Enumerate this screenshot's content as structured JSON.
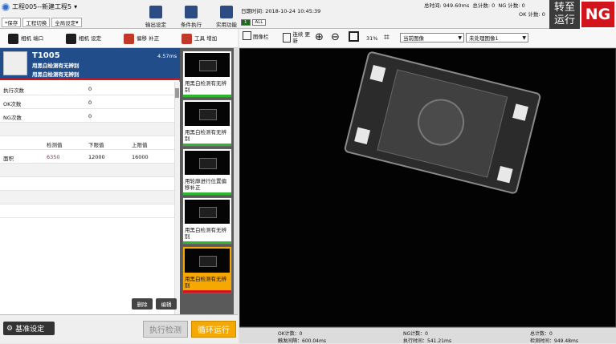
{
  "header": {
    "project": "工程005--新建工程5",
    "save": "*保存",
    "switch_project": "工程切换",
    "global_settings": "全局设定",
    "toolbar": [
      "输出设定",
      "条件执行",
      "实用功能"
    ],
    "datetime": "日期时间: 2018-10-24 10:45:39",
    "chips": [
      "1",
      "ALL"
    ],
    "stats": {
      "total_time": "总时间: 949.60ms",
      "total_count": "总计数: 0",
      "ng_count": "NG 计数: 0",
      "ok_count": "OK 计数: 0"
    },
    "run": "转至运行",
    "status": "NG"
  },
  "left_toolbar": [
    {
      "label": "相机 端口"
    },
    {
      "label": "相机 设定"
    },
    {
      "label": "偏移 补正"
    },
    {
      "label": "工具 增加"
    }
  ],
  "tool": {
    "id": "T1005",
    "time": "4.57ms",
    "name1": "用黑白检测有无辨别",
    "name2": "用黑白检测有无辨别",
    "rows": [
      {
        "label": "执行次数",
        "value": "0"
      },
      {
        "label": "OK次数",
        "value": "0"
      },
      {
        "label": "NG次数",
        "value": "0"
      }
    ],
    "table_headers": [
      "检测值",
      "下限值",
      "上限值"
    ],
    "table_row": {
      "label": "面积",
      "measured": "6350",
      "min": "12000",
      "max": "16000"
    },
    "delete": "删除",
    "edit": "编辑"
  },
  "thumbnails": [
    {
      "label": "用黑白检测有无辨别"
    },
    {
      "label": "用黑白检测有无辨别"
    },
    {
      "label": "用轮廓进行位置偏移补正"
    },
    {
      "label": "用黑白检测有无辨别"
    },
    {
      "label": "用黑白检测有无辨别"
    }
  ],
  "bottom": {
    "base": "基准设定",
    "exec": "执行检测",
    "loop": "循环运行"
  },
  "image_toolbar": {
    "image_bar": "图像栏",
    "continuous_update": "连续 更新",
    "zoom": "31%",
    "select1": "当前图像",
    "select2": "未处理图像1"
  },
  "view_stats": {
    "ok_count": "OK计数：0",
    "ng_count": "NG计数：0",
    "total_count": "总计数：0",
    "trigger_interval": "触发间隔：600.04ms",
    "exec_time": "执行时间：541.21ms",
    "check_time": "检测时间：949.48ms"
  },
  "colors": {
    "accent": "#214e8a",
    "ng": "#d2151c",
    "loop": "#f5a800"
  }
}
